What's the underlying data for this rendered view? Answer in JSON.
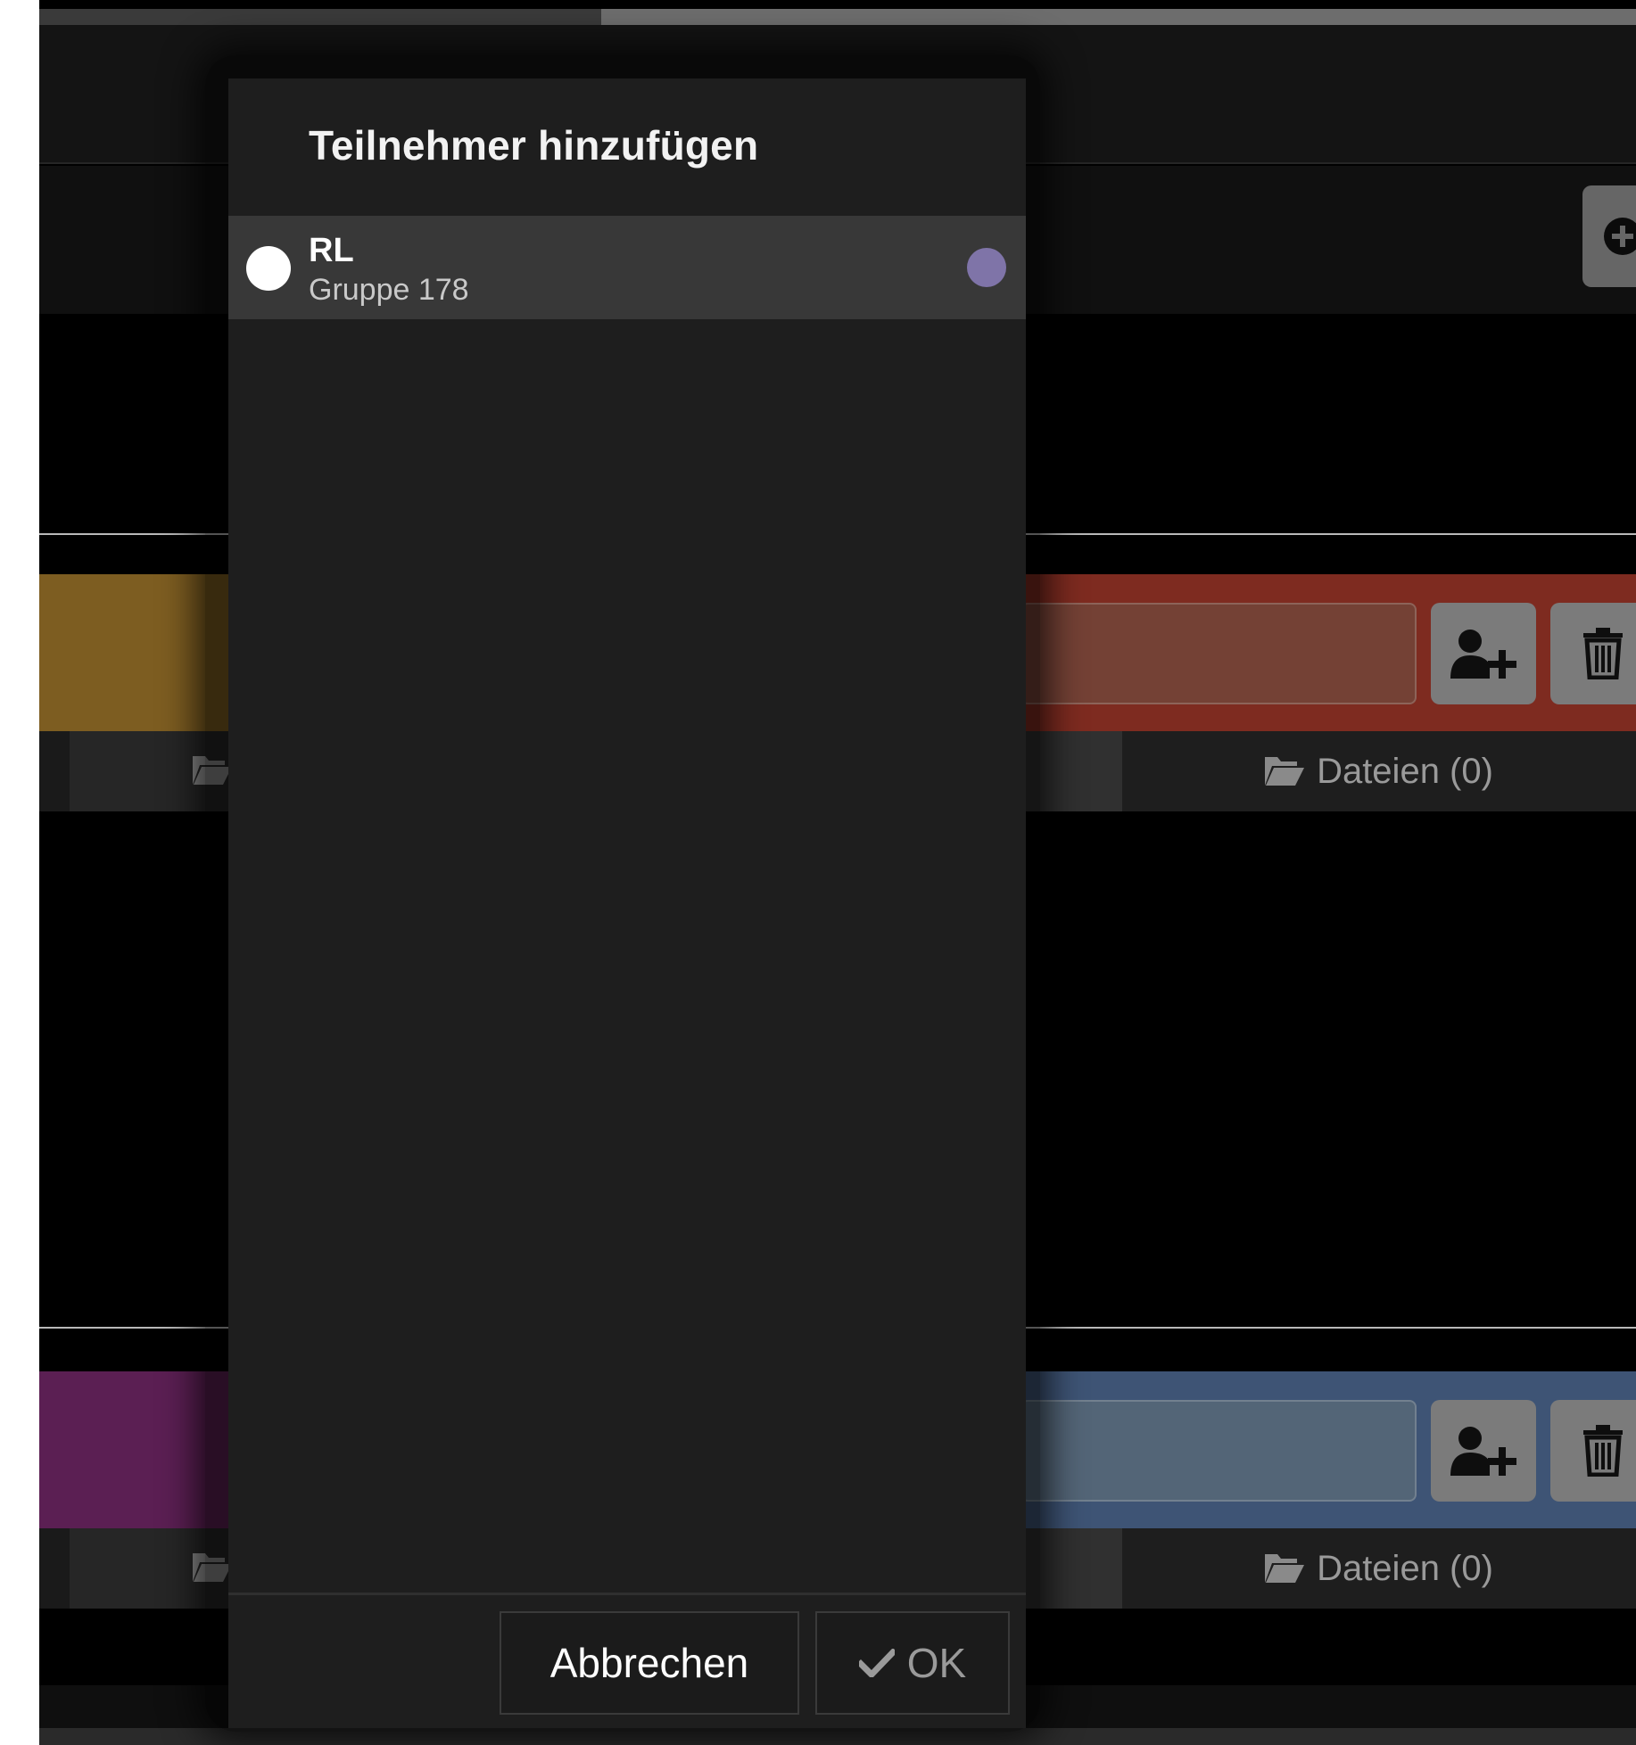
{
  "dialog": {
    "title": "Teilnehmer hinzufügen",
    "participants": [
      {
        "name": "RL",
        "group": "Gruppe 178",
        "color": "#7f74a8",
        "selected": false
      }
    ],
    "buttons": {
      "cancel": "Abbrechen",
      "ok": "OK"
    }
  },
  "background": {
    "rows": [
      {
        "left_color": "#7d5d21",
        "right_color": "#7e2b20",
        "field_color": "#744135",
        "files_label": "Dateien (0)"
      },
      {
        "left_color": "#5b1f53",
        "right_color": "#3e5475",
        "field_color": "#536577",
        "files_label": "Dateien (0)"
      }
    ]
  },
  "icons": {
    "add_icon": "plus-circle-icon",
    "user_add_icon": "user-plus-icon",
    "delete_icon": "trash-icon",
    "folder_icon": "folder-open-icon",
    "check_icon": "check-icon"
  }
}
